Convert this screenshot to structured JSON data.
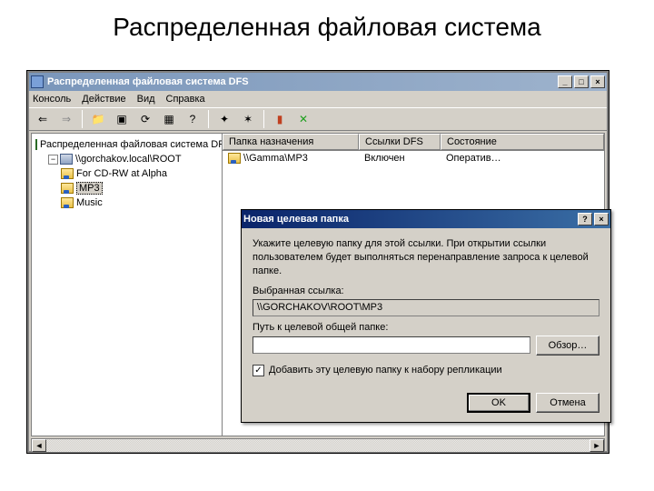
{
  "slide": {
    "title": "Распределенная файловая система"
  },
  "mmc": {
    "window_title": "Распределенная файловая система DFS",
    "menu": {
      "console": "Консоль",
      "action": "Действие",
      "view": "Вид",
      "help": "Справка"
    },
    "tree": {
      "root": "Распределенная файловая система DFS",
      "host": "\\\\gorchakov.local\\ROOT",
      "items": [
        {
          "label": "For CD-RW at Alpha"
        },
        {
          "label": "MP3"
        },
        {
          "label": "Music"
        }
      ]
    },
    "list": {
      "columns": {
        "target": "Папка назначения",
        "links": "Ссылки DFS",
        "state": "Состояние"
      },
      "row": {
        "target": "\\\\Gamma\\MP3",
        "links": "Включен",
        "state": "Оператив…"
      }
    }
  },
  "dialog": {
    "title": "Новая целевая папка",
    "instruction": "Укажите целевую папку для этой ссылки. При открытии ссылки пользователем будет выполняться перенаправление запроса к целевой папке.",
    "selected_label": "Выбранная ссылка:",
    "selected_value": "\\\\GORCHAKOV\\ROOT\\MP3",
    "path_label": "Путь к целевой общей папке:",
    "path_value": "",
    "browse": "Обзор…",
    "checkbox_label": "Добавить эту целевую папку к набору репликации",
    "checkbox_checked": "✓",
    "ok": "OK",
    "cancel": "Отмена"
  }
}
